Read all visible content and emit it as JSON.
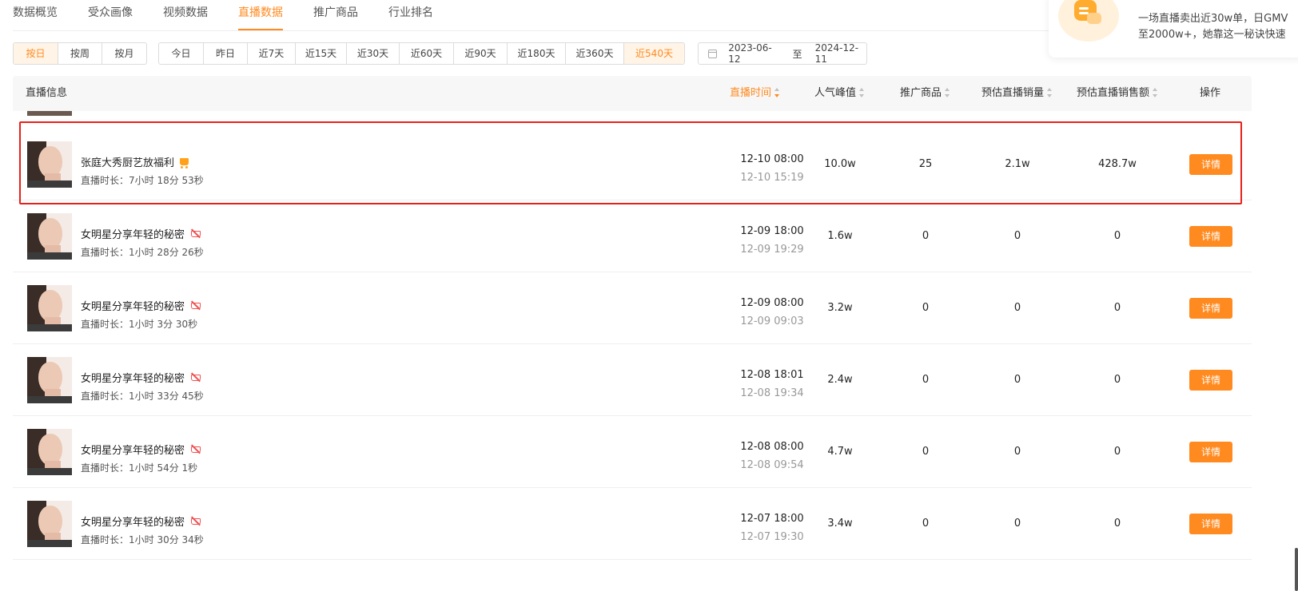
{
  "tabs": [
    "数据概览",
    "受众画像",
    "视频数据",
    "直播数据",
    "推广商品",
    "行业排名"
  ],
  "active_tab": "直播数据",
  "promo": {
    "line1": "一场直播卖出近30w单，日GMV",
    "line2": "至2000w+，她靠这一秘诀快速"
  },
  "period_buttons": [
    "按日",
    "按周",
    "按月"
  ],
  "range_buttons": [
    "今日",
    "昨日",
    "近7天",
    "近15天",
    "近30天",
    "近60天",
    "近90天",
    "近180天",
    "近360天",
    "近540天"
  ],
  "date_range": {
    "start": "2023-06-12",
    "separator": "至",
    "end": "2024-12-11"
  },
  "columns": {
    "info": "直播信息",
    "time": "直播时间",
    "peak": "人气峰值",
    "products": "推广商品",
    "sales_volume": "预估直播销量",
    "sales_amount": "预估直播销售额",
    "action": "操作"
  },
  "rows": [
    {
      "title": "张庭大秀厨艺放福利",
      "has_cart": true,
      "duration": "直播时长：7小时 18分 53秒",
      "start": "12-10 08:00",
      "end": "12-10 15:19",
      "peak": "10.0w",
      "products": "25",
      "sales_volume": "2.1w",
      "sales_amount": "428.7w",
      "action": "详情"
    },
    {
      "title": "女明星分享年轻的秘密",
      "has_cart": false,
      "duration": "直播时长：1小时 28分 26秒",
      "start": "12-09 18:00",
      "end": "12-09 19:29",
      "peak": "1.6w",
      "products": "0",
      "sales_volume": "0",
      "sales_amount": "0",
      "action": "详情"
    },
    {
      "title": "女明星分享年轻的秘密",
      "has_cart": false,
      "duration": "直播时长：1小时 3分 30秒",
      "start": "12-09 08:00",
      "end": "12-09 09:03",
      "peak": "3.2w",
      "products": "0",
      "sales_volume": "0",
      "sales_amount": "0",
      "action": "详情"
    },
    {
      "title": "女明星分享年轻的秘密",
      "has_cart": false,
      "duration": "直播时长：1小时 33分 45秒",
      "start": "12-08 18:01",
      "end": "12-08 19:34",
      "peak": "2.4w",
      "products": "0",
      "sales_volume": "0",
      "sales_amount": "0",
      "action": "详情"
    },
    {
      "title": "女明星分享年轻的秘密",
      "has_cart": false,
      "duration": "直播时长：1小时 54分 1秒",
      "start": "12-08 08:00",
      "end": "12-08 09:54",
      "peak": "4.7w",
      "products": "0",
      "sales_volume": "0",
      "sales_amount": "0",
      "action": "详情"
    },
    {
      "title": "女明星分享年轻的秘密",
      "has_cart": false,
      "duration": "直播时长：1小时 30分 34秒",
      "start": "12-07 18:00",
      "end": "12-07 19:30",
      "peak": "3.4w",
      "products": "0",
      "sales_volume": "0",
      "sales_amount": "0",
      "action": "详情"
    }
  ],
  "colors": {
    "accent": "#ff8a1f",
    "highlight": "#e8201a"
  }
}
